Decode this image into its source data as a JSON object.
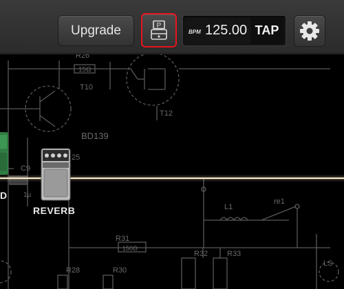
{
  "toolbar": {
    "upgrade_label": "Upgrade",
    "pedal_icon_letter": "P",
    "bpm_label": "BPM",
    "bpm_value": "125.00",
    "tap_label": "TAP"
  },
  "pedalboard": {
    "pedal_label": "REVERB",
    "partial_left_label": "D"
  },
  "schematic": {
    "labels": [
      "R26",
      "15Ω",
      "T10",
      "T12",
      "BD139",
      "25",
      "C9",
      "1μ",
      "L1",
      "re1",
      "R31",
      "150Ω",
      "R28",
      "R30",
      "R32",
      "R33",
      "LS"
    ]
  },
  "colors": {
    "highlight_border": "#e8141c",
    "signal_line": "#f4e2b0",
    "schematic_line": "#5a5a5a"
  },
  "icons": [
    "pedal-icon",
    "gear-icon"
  ]
}
